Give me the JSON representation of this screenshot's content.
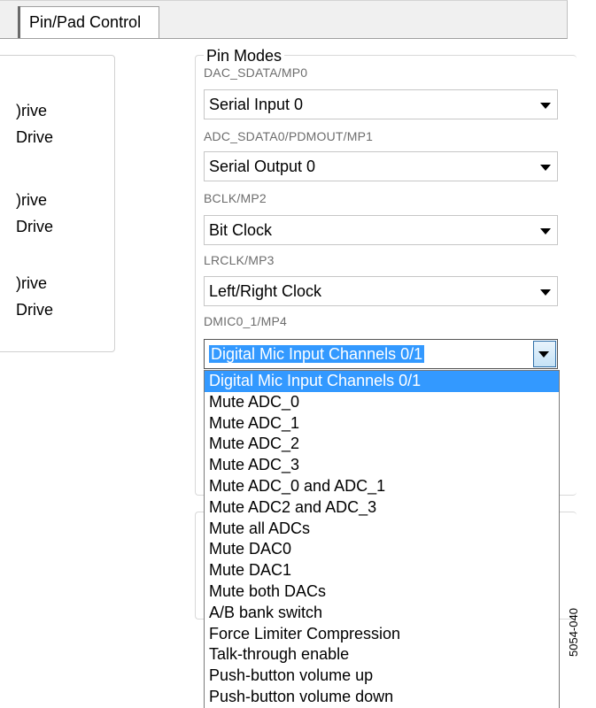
{
  "tab": {
    "label": "Pin/Pad Control"
  },
  "left_panel": {
    "drive_labels": [
      ")rive",
      "Drive",
      ")rive",
      "Drive",
      ")rive",
      "Drive"
    ]
  },
  "pin_modes": {
    "title": "Pin Modes",
    "pins": [
      {
        "label": "DAC_SDATA/MP0",
        "value": "Serial Input 0"
      },
      {
        "label": "ADC_SDATA0/PDMOUT/MP1",
        "value": "Serial Output 0"
      },
      {
        "label": "BCLK/MP2",
        "value": "Bit Clock"
      },
      {
        "label": "LRCLK/MP3",
        "value": "Left/Right Clock"
      },
      {
        "label": "DMIC0_1/MP4",
        "value": "Digital Mic Input Channels 0/1"
      }
    ]
  },
  "dropdown": {
    "selected": "Digital Mic Input Channels 0/1",
    "options": [
      "Digital Mic Input Channels 0/1",
      "Mute ADC_0",
      "Mute ADC_1",
      "Mute ADC_2",
      "Mute ADC_3",
      "Mute ADC_0 and ADC_1",
      "Mute ADC2 and ADC_3",
      "Mute all ADCs",
      "Mute DAC0",
      "Mute DAC1",
      "Mute both DACs",
      "A/B bank switch",
      "Force Limiter Compression",
      "Talk-through enable",
      "Push-button volume up",
      "Push-button volume down"
    ]
  },
  "figure_id": "5054-040"
}
